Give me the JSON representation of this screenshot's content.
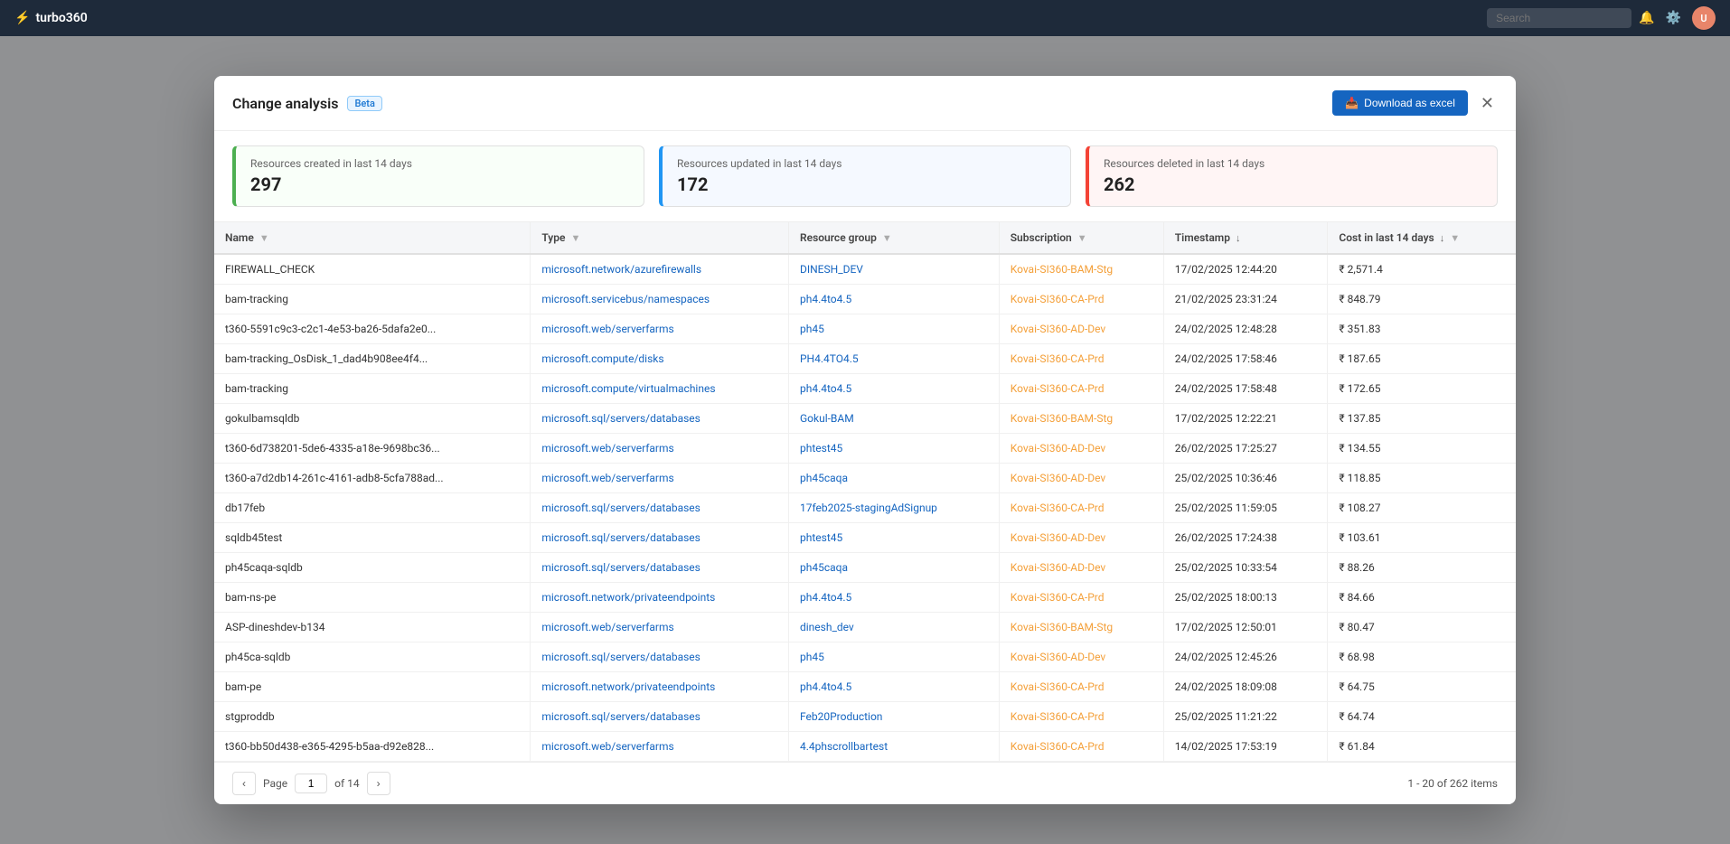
{
  "topbar": {
    "brand": "turbo360",
    "search_placeholder": "Search",
    "avatar_initials": "U"
  },
  "modal": {
    "title": "Change analysis",
    "badge": "Beta",
    "download_label": "Download as excel",
    "stats": [
      {
        "label": "Resources created in last 14 days",
        "value": "297",
        "color": "green"
      },
      {
        "label": "Resources updated in last 14 days",
        "value": "172",
        "color": "blue"
      },
      {
        "label": "Resources deleted in last 14 days",
        "value": "262",
        "color": "red"
      }
    ],
    "table": {
      "columns": [
        {
          "key": "name",
          "label": "Name",
          "filter": true,
          "sort": false
        },
        {
          "key": "type",
          "label": "Type",
          "filter": true,
          "sort": false
        },
        {
          "key": "resource_group",
          "label": "Resource group",
          "filter": true,
          "sort": false
        },
        {
          "key": "subscription",
          "label": "Subscription",
          "filter": true,
          "sort": false
        },
        {
          "key": "timestamp",
          "label": "Timestamp",
          "filter": false,
          "sort": true
        },
        {
          "key": "cost",
          "label": "Cost in last 14 days",
          "filter": true,
          "sort": true
        }
      ],
      "rows": [
        {
          "name": "FIREWALL_CHECK",
          "type": "microsoft.network/azurefirewalls",
          "resource_group": "DINESH_DEV",
          "subscription": "Kovai-SI360-BAM-Stg",
          "timestamp": "17/02/2025 12:44:20",
          "cost": "₹ 2,571.4"
        },
        {
          "name": "bam-tracking",
          "type": "microsoft.servicebus/namespaces",
          "resource_group": "ph4.4to4.5",
          "subscription": "Kovai-SI360-CA-Prd",
          "timestamp": "21/02/2025 23:31:24",
          "cost": "₹ 848.79"
        },
        {
          "name": "t360-5591c9c3-c2c1-4e53-ba26-5dafa2e0...",
          "type": "microsoft.web/serverfarms",
          "resource_group": "ph45",
          "subscription": "Kovai-SI360-AD-Dev",
          "timestamp": "24/02/2025 12:48:28",
          "cost": "₹ 351.83"
        },
        {
          "name": "bam-tracking_OsDisk_1_dad4b908ee4f4...",
          "type": "microsoft.compute/disks",
          "resource_group": "PH4.4TO4.5",
          "subscription": "Kovai-SI360-CA-Prd",
          "timestamp": "24/02/2025 17:58:46",
          "cost": "₹ 187.65"
        },
        {
          "name": "bam-tracking",
          "type": "microsoft.compute/virtualmachines",
          "resource_group": "ph4.4to4.5",
          "subscription": "Kovai-SI360-CA-Prd",
          "timestamp": "24/02/2025 17:58:48",
          "cost": "₹ 172.65"
        },
        {
          "name": "gokulbamsqldb",
          "type": "microsoft.sql/servers/databases",
          "resource_group": "Gokul-BAM",
          "subscription": "Kovai-SI360-BAM-Stg",
          "timestamp": "17/02/2025 12:22:21",
          "cost": "₹ 137.85"
        },
        {
          "name": "t360-6d738201-5de6-4335-a18e-9698bc36...",
          "type": "microsoft.web/serverfarms",
          "resource_group": "phtest45",
          "subscription": "Kovai-SI360-AD-Dev",
          "timestamp": "26/02/2025 17:25:27",
          "cost": "₹ 134.55"
        },
        {
          "name": "t360-a7d2db14-261c-4161-adb8-5cfa788ad...",
          "type": "microsoft.web/serverfarms",
          "resource_group": "ph45caqa",
          "subscription": "Kovai-SI360-AD-Dev",
          "timestamp": "25/02/2025 10:36:46",
          "cost": "₹ 118.85"
        },
        {
          "name": "db17feb",
          "type": "microsoft.sql/servers/databases",
          "resource_group": "17feb2025-stagingAdSignup",
          "subscription": "Kovai-SI360-CA-Prd",
          "timestamp": "25/02/2025 11:59:05",
          "cost": "₹ 108.27"
        },
        {
          "name": "sqldb45test",
          "type": "microsoft.sql/servers/databases",
          "resource_group": "phtest45",
          "subscription": "Kovai-SI360-AD-Dev",
          "timestamp": "26/02/2025 17:24:38",
          "cost": "₹ 103.61"
        },
        {
          "name": "ph45caqa-sqldb",
          "type": "microsoft.sql/servers/databases",
          "resource_group": "ph45caqa",
          "subscription": "Kovai-SI360-AD-Dev",
          "timestamp": "25/02/2025 10:33:54",
          "cost": "₹ 88.26"
        },
        {
          "name": "bam-ns-pe",
          "type": "microsoft.network/privateendpoints",
          "resource_group": "ph4.4to4.5",
          "subscription": "Kovai-SI360-CA-Prd",
          "timestamp": "25/02/2025 18:00:13",
          "cost": "₹ 84.66"
        },
        {
          "name": "ASP-dineshdev-b134",
          "type": "microsoft.web/serverfarms",
          "resource_group": "dinesh_dev",
          "subscription": "Kovai-SI360-BAM-Stg",
          "timestamp": "17/02/2025 12:50:01",
          "cost": "₹ 80.47"
        },
        {
          "name": "ph45ca-sqldb",
          "type": "microsoft.sql/servers/databases",
          "resource_group": "ph45",
          "subscription": "Kovai-SI360-AD-Dev",
          "timestamp": "24/02/2025 12:45:26",
          "cost": "₹ 68.98"
        },
        {
          "name": "bam-pe",
          "type": "microsoft.network/privateendpoints",
          "resource_group": "ph4.4to4.5",
          "subscription": "Kovai-SI360-CA-Prd",
          "timestamp": "24/02/2025 18:09:08",
          "cost": "₹ 64.75"
        },
        {
          "name": "stgproddb",
          "type": "microsoft.sql/servers/databases",
          "resource_group": "Feb20Production",
          "subscription": "Kovai-SI360-CA-Prd",
          "timestamp": "25/02/2025 11:21:22",
          "cost": "₹ 64.74"
        },
        {
          "name": "t360-bb50d438-e365-4295-b5aa-d92e828...",
          "type": "microsoft.web/serverfarms",
          "resource_group": "4.4phscrollbartest",
          "subscription": "Kovai-SI360-CA-Prd",
          "timestamp": "14/02/2025 17:53:19",
          "cost": "₹ 61.84"
        }
      ]
    },
    "pagination": {
      "page_label": "Page",
      "current_page": "1",
      "of_label": "of 14",
      "total_label": "1 - 20 of 262 items"
    }
  }
}
